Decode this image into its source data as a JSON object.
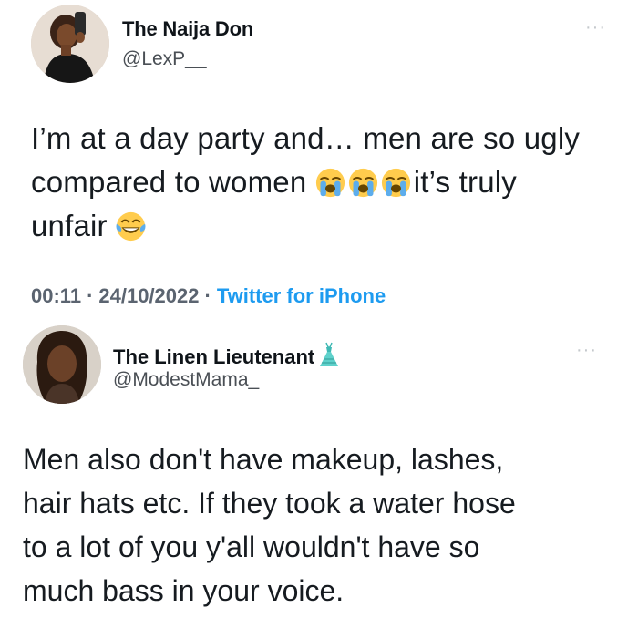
{
  "tweet1": {
    "author_name": "The Naija Don",
    "handle": "@LexP__",
    "more_label": "···",
    "body_line1": "I’m at a day party and… men are so ugly",
    "body_line2_text": "compared to women",
    "body_line2_tail": "it’s truly",
    "body_line3_text": "unfair",
    "emoji_names": [
      "loudly-crying-face",
      "loudly-crying-face",
      "loudly-crying-face",
      "face-with-tears-of-joy"
    ],
    "time": "00:11",
    "date": "24/10/2022",
    "separator": "·",
    "source": "Twitter for iPhone",
    "accent_color": "#1d9bf0"
  },
  "tweet2": {
    "author_name": "The Linen Lieutenant",
    "name_icon": "dress-icon",
    "handle": "@ModestMama_",
    "more_label": "···",
    "body_lines": [
      "Men also don't have makeup, lashes,",
      "hair hats etc. If they took a water hose",
      "to a lot of you y'all wouldn't have so",
      "much bass in your voice."
    ]
  }
}
